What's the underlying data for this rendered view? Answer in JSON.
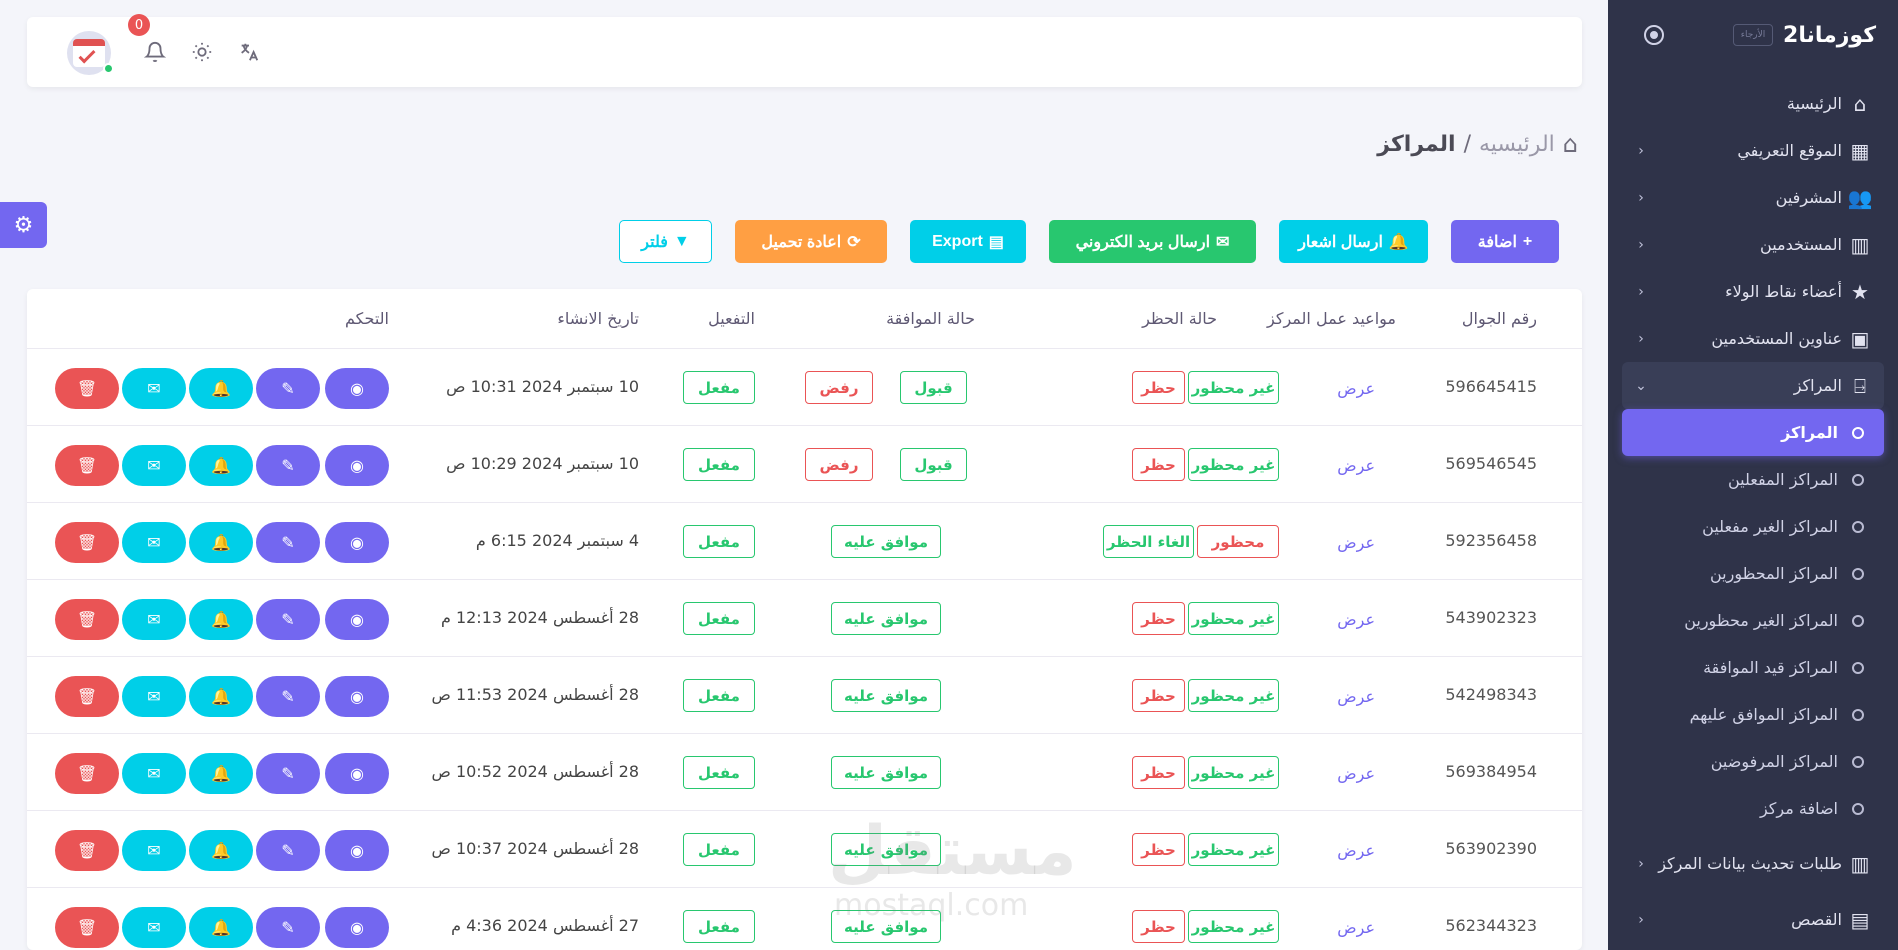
{
  "sidebar": {
    "brand": "كوزمانا2",
    "logo_text": "الأرجاء",
    "items": [
      {
        "label": "الرئيسية",
        "icon": "home-icon",
        "chevron": false
      },
      {
        "label": "الموقع التعريفي",
        "icon": "map-icon",
        "chevron": true
      },
      {
        "label": "المشرفين",
        "icon": "users-icon",
        "chevron": true
      },
      {
        "label": "المستخدمين",
        "icon": "building-icon",
        "chevron": true
      },
      {
        "label": "أعضاء نقاط الولاء",
        "icon": "star-icon",
        "chevron": true
      },
      {
        "label": "عناوين المستخدمين",
        "icon": "address-card-icon",
        "chevron": true
      },
      {
        "label": "المراكز",
        "icon": "door-icon",
        "chevron": true
      }
    ],
    "sub_items": [
      {
        "label": "المراكز"
      },
      {
        "label": "المراكز المفعلين"
      },
      {
        "label": "المراكز الغير مفعلين"
      },
      {
        "label": "المراكز المحظورين"
      },
      {
        "label": "المراكز الغير محظورين"
      },
      {
        "label": "المراكز قيد الموافقة"
      },
      {
        "label": "المراكز الموافق عليهم"
      },
      {
        "label": "المراكز المرفوضين"
      },
      {
        "label": "اضافة مركز"
      }
    ],
    "bottom_items": [
      {
        "label": "طلبات تحديث بيانات المركز",
        "icon": "building-icon"
      },
      {
        "label": "القصص",
        "icon": "film-icon"
      }
    ]
  },
  "topbar": {
    "notification_count": "0"
  },
  "breadcrumb": {
    "home": "الرئيسيه",
    "separator": "/",
    "current": "المراكز"
  },
  "actions": {
    "add": "اضافة",
    "send_notification": "ارسال اشعار",
    "send_email": "ارسال بريد الكتروني",
    "export": "Export",
    "reload": "اعادة تحميل",
    "filter": "فلتر"
  },
  "table": {
    "headers": {
      "phone": "رقم الجوال",
      "hours": "مواعيد عمل المركز",
      "ban_status": "حالة الحظر",
      "approval_status": "حالة الموافقة",
      "activation": "التفعيل",
      "created_at": "تاريخ الانشاء",
      "control": "التحكم"
    },
    "rows": [
      {
        "phone": "596645415",
        "hours": "عرض",
        "ban_state": "غير محظور",
        "ban_action": "حظر",
        "approval": "pending",
        "accept": "قبول",
        "reject": "رفض",
        "approved": "",
        "active": "مفعل",
        "date": "10 سبتمبر 2024 10:31 ص"
      },
      {
        "phone": "569546545",
        "hours": "عرض",
        "ban_state": "غير محظور",
        "ban_action": "حظر",
        "approval": "pending",
        "accept": "قبول",
        "reject": "رفض",
        "approved": "",
        "active": "مفعل",
        "date": "10 سبتمبر 2024 10:29 ص"
      },
      {
        "phone": "592356458",
        "hours": "عرض",
        "ban_state": "محظور",
        "ban_action": "الغاء الحظر",
        "approval": "approved",
        "accept": "",
        "reject": "",
        "approved": "موافق عليه",
        "active": "مفعل",
        "date": "4 سبتمبر 2024 6:15 م"
      },
      {
        "phone": "543902323",
        "hours": "عرض",
        "ban_state": "غير محظور",
        "ban_action": "حظر",
        "approval": "approved",
        "accept": "",
        "reject": "",
        "approved": "موافق عليه",
        "active": "مفعل",
        "date": "28 أغسطس 2024 12:13 م"
      },
      {
        "phone": "542498343",
        "hours": "عرض",
        "ban_state": "غير محظور",
        "ban_action": "حظر",
        "approval": "approved",
        "accept": "",
        "reject": "",
        "approved": "موافق عليه",
        "active": "مفعل",
        "date": "28 أغسطس 2024 11:53 ص"
      },
      {
        "phone": "569384954",
        "hours": "عرض",
        "ban_state": "غير محظور",
        "ban_action": "حظر",
        "approval": "approved",
        "accept": "",
        "reject": "",
        "approved": "موافق عليه",
        "active": "مفعل",
        "date": "28 أغسطس 2024 10:52 ص"
      },
      {
        "phone": "563902390",
        "hours": "عرض",
        "ban_state": "غير محظور",
        "ban_action": "حظر",
        "approval": "approved",
        "accept": "",
        "reject": "",
        "approved": "موافق عليه",
        "active": "مفعل",
        "date": "28 أغسطس 2024 10:37 ص"
      },
      {
        "phone": "562344323",
        "hours": "عرض",
        "ban_state": "غير محظور",
        "ban_action": "حظر",
        "approval": "approved",
        "accept": "",
        "reject": "",
        "approved": "موافق عليه",
        "active": "مفعل",
        "date": "27 أغسطس 2024 4:36 م"
      }
    ]
  },
  "watermark": {
    "text": "مستقل",
    "sub": "mostaql.com"
  },
  "colors": {
    "primary": "#7367f0",
    "info": "#00cfe8",
    "success": "#28c76f",
    "danger": "#ea5455",
    "warning": "#ff9f43",
    "sidebar_bg": "#2f3349"
  }
}
